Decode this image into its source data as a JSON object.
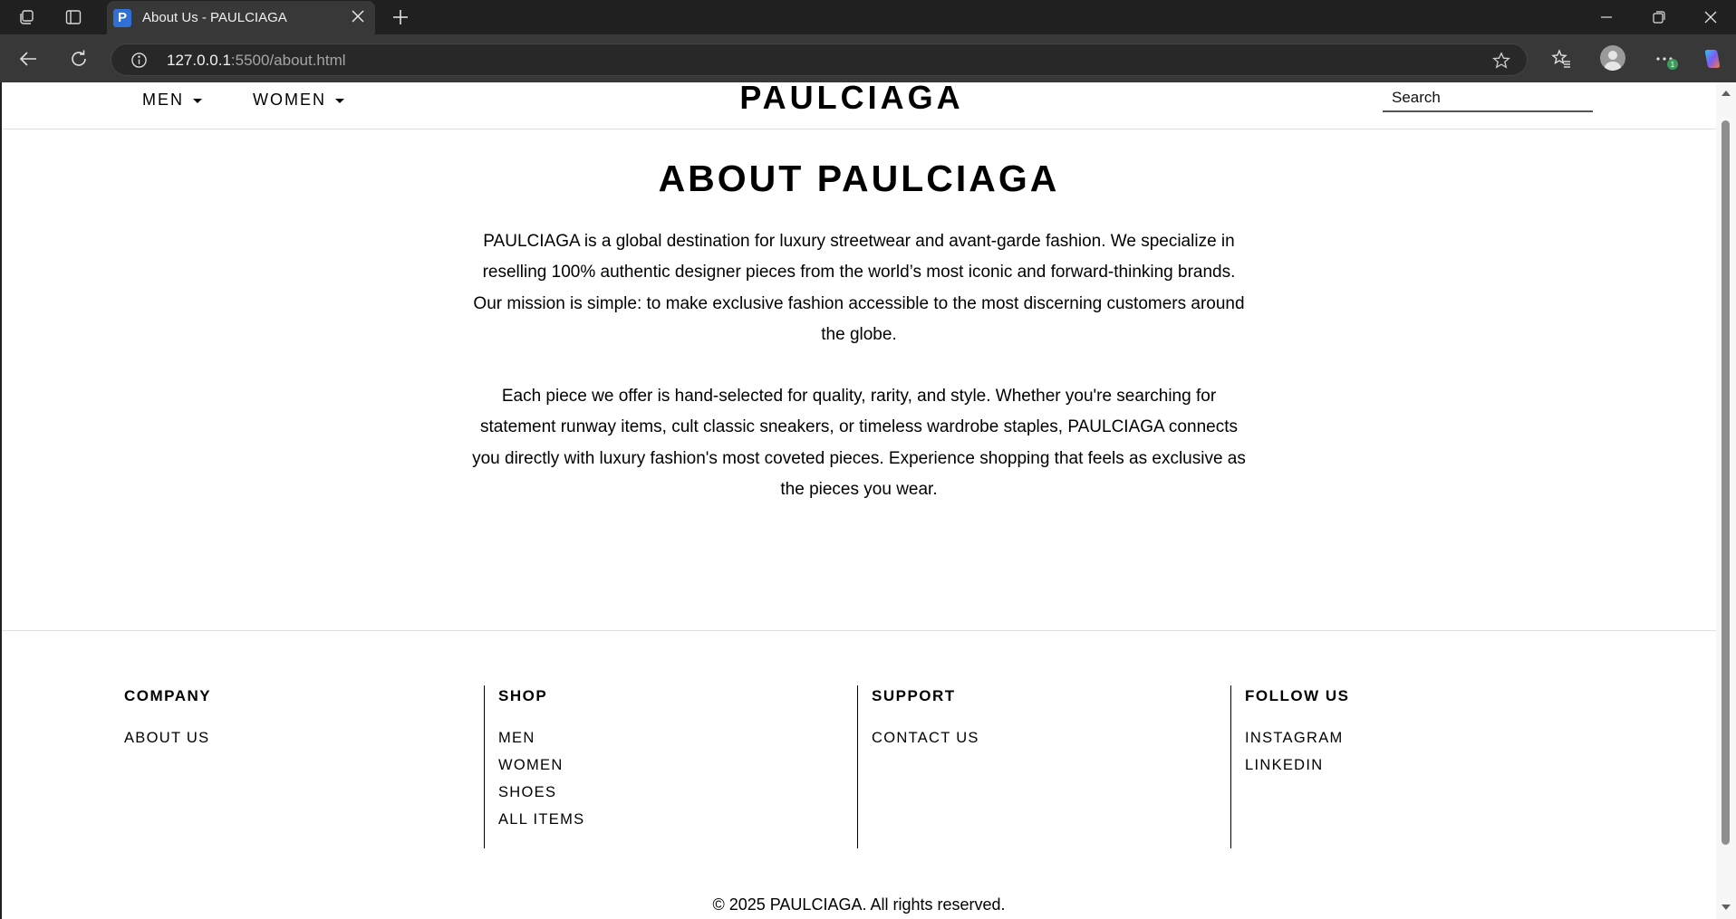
{
  "browser": {
    "tab_title": "About Us - PAULCIAGA",
    "favicon_letter": "P",
    "url_host": "127.0.0.1",
    "url_rest": ":5500/about.html",
    "badge_count": "1"
  },
  "header": {
    "nav": [
      {
        "label": "MEN"
      },
      {
        "label": "WOMEN"
      }
    ],
    "logo": "PAULCIAGA",
    "search_placeholder": "Search"
  },
  "main": {
    "title": "ABOUT PAULCIAGA",
    "paragraphs": [
      "PAULCIAGA is a global destination for luxury streetwear and avant-garde fashion. We specialize in reselling 100% authentic designer pieces from the world’s most iconic and forward-thinking brands. Our mission is simple: to make exclusive fashion accessible to the most discerning customers around the globe.",
      "Each piece we offer is hand-selected for quality, rarity, and style. Whether you're searching for statement runway items, cult classic sneakers, or timeless wardrobe staples, PAULCIAGA connects you directly with luxury fashion's most coveted pieces. Experience shopping that feels as exclusive as the pieces you wear."
    ]
  },
  "footer": {
    "columns": [
      {
        "heading": "COMPANY",
        "links": [
          "ABOUT US"
        ]
      },
      {
        "heading": "SHOP",
        "links": [
          "MEN",
          "WOMEN",
          "SHOES",
          "ALL ITEMS"
        ]
      },
      {
        "heading": "SUPPORT",
        "links": [
          "CONTACT US"
        ]
      },
      {
        "heading": "FOLLOW US",
        "links": [
          "INSTAGRAM",
          "LINKEDIN"
        ]
      }
    ],
    "copyright": "© 2025 PAULCIAGA. All rights reserved."
  },
  "icons": {
    "workspaces": "workspaces-icon",
    "tab_actions": "tab-actions-icon",
    "new_tab": "plus-icon",
    "back": "back-arrow-icon",
    "refresh": "refresh-icon",
    "site_info": "info-icon",
    "favorite": "star-icon",
    "favorites": "favorites-icon",
    "profile": "profile-icon",
    "more": "more-icon",
    "copilot": "copilot-icon"
  }
}
